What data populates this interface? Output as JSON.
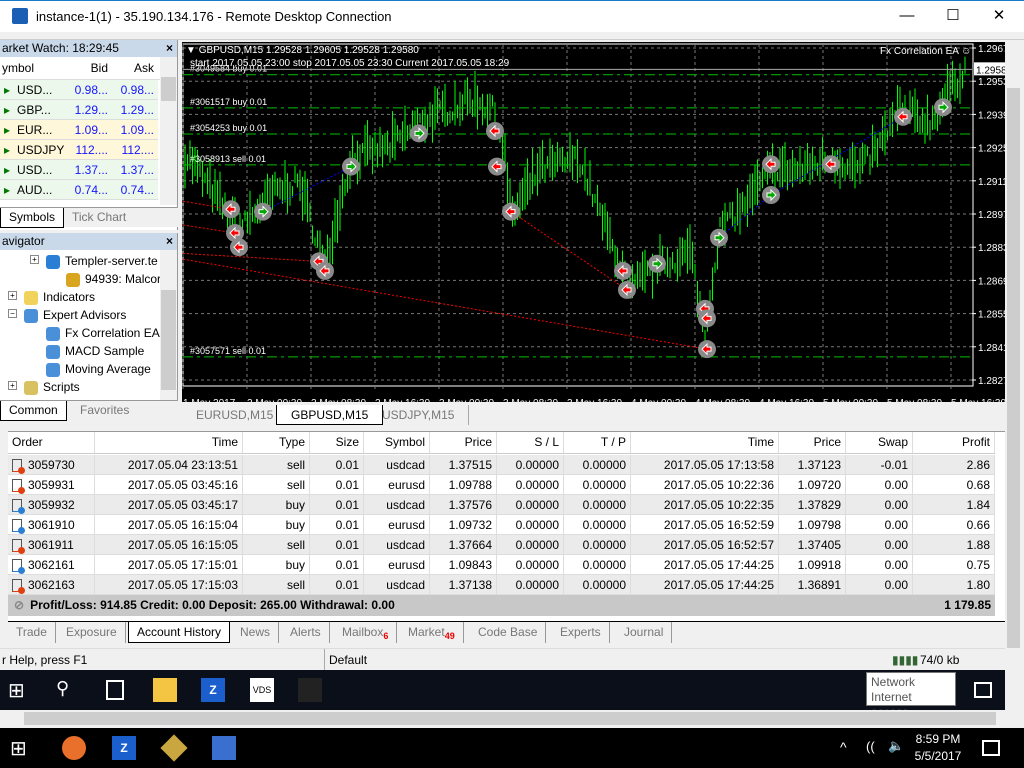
{
  "window": {
    "title": "instance-1(1) - 35.190.134.176 - Remote Desktop Connection",
    "minimize": "—",
    "maximize": "☐",
    "close": "✕"
  },
  "market_watch": {
    "title": "arket Watch: 18:29:45",
    "columns": [
      "ymbol",
      "Bid",
      "Ask"
    ],
    "rows": [
      {
        "symbol": "USD...",
        "bid": "0.98...",
        "ask": "0.98..."
      },
      {
        "symbol": "GBP...",
        "bid": "1.29...",
        "ask": "1.29..."
      },
      {
        "symbol": "EUR...",
        "bid": "1.09...",
        "ask": "1.09..."
      },
      {
        "symbol": "USDJPY",
        "bid": "112....",
        "ask": "112...."
      },
      {
        "symbol": "USD...",
        "bid": "1.37...",
        "ask": "1.37..."
      },
      {
        "symbol": "AUD...",
        "bid": "0.74...",
        "ask": "0.74..."
      }
    ],
    "tabs": [
      "Symbols",
      "Tick Chart"
    ]
  },
  "navigator": {
    "title": "avigator",
    "items": [
      {
        "label": "Templer-server.te",
        "icon": "server-icon"
      },
      {
        "label": "94939: Malcor",
        "icon": "account-icon"
      },
      {
        "label": "Indicators",
        "icon": "indicator-icon"
      },
      {
        "label": "Expert Advisors",
        "icon": "expert-icon"
      },
      {
        "label": "Fx Correlation EA",
        "icon": "expert-icon"
      },
      {
        "label": "MACD Sample",
        "icon": "expert-icon"
      },
      {
        "label": "Moving Average",
        "icon": "expert-icon"
      },
      {
        "label": "Scripts",
        "icon": "script-icon"
      }
    ],
    "tabs": [
      "Common",
      "Favorites"
    ]
  },
  "chart": {
    "header": "GBPUSD,M15  1.29528 1.29605 1.29528 1.29580",
    "info": "start 2017.05.05 23:00 stop 2017.05.05 23:30 Current 2017.05.05 18:29",
    "ea_label": "Fx Correlation EA",
    "current_price": "1.2958",
    "price_ticks": [
      "1.2967",
      "1.2953",
      "1.2939",
      "1.2925",
      "1.2911",
      "1.2897",
      "1.2883",
      "1.2869",
      "1.2855",
      "1.2841",
      "1.2827"
    ],
    "time_ticks": [
      "1 May 2017",
      "2 May 00:30",
      "2 May 08:30",
      "2 May 16:30",
      "3 May 00:30",
      "3 May 08:30",
      "3 May 16:30",
      "4 May 00:30",
      "4 May 08:30",
      "4 May 16:30",
      "5 May 00:30",
      "5 May 08:30",
      "5 May 16:30"
    ],
    "price_path": [
      [
        "05.01 17:15",
        1.292
      ],
      [
        "05.01 23:30",
        1.289
      ],
      [
        "05.02 03:30",
        1.2905
      ],
      [
        "05.02 07:00",
        1.291
      ],
      [
        "05.02 10:15",
        1.2875
      ],
      [
        "05.02 13:30",
        1.292
      ],
      [
        "05.02 18:30",
        1.2925
      ],
      [
        "05.02 22:00",
        1.2935
      ],
      [
        "05.03 04:30",
        1.2945
      ],
      [
        "05.03 07:30",
        1.294
      ],
      [
        "05.03 08:45",
        1.292
      ],
      [
        "05.03 09:30",
        1.2895
      ],
      [
        "05.03 13:00",
        1.2915
      ],
      [
        "05.03 18:00",
        1.292
      ],
      [
        "05.03 22:30",
        1.288
      ],
      [
        "05.04 00:30",
        1.2865
      ],
      [
        "05.04 04:00",
        1.2875
      ],
      [
        "05.04 08:00",
        1.288
      ],
      [
        "05.04 09:45",
        1.2845
      ],
      [
        "05.04 11:30",
        1.289
      ],
      [
        "05.04 14:45",
        1.29
      ],
      [
        "05.04 18:00",
        1.2915
      ],
      [
        "05.04 21:30",
        1.2915
      ],
      [
        "05.05 01:30",
        1.292
      ],
      [
        "05.05 05:00",
        1.2915
      ],
      [
        "05.05 07:30",
        1.2925
      ],
      [
        "05.05 10:00",
        1.294
      ],
      [
        "05.05 14:00",
        1.2935
      ],
      [
        "05.05 15:45",
        1.2945
      ],
      [
        "05.05 18:15",
        1.2958
      ]
    ],
    "order_lines": [
      {
        "label": "#3049584 buy 0.01",
        "price": 1.2957
      },
      {
        "label": "#3061517 buy 0.01",
        "price": 1.2943
      },
      {
        "label": "#3054253 buy 0.01",
        "price": 1.2932
      },
      {
        "label": "#3058913 sell 0.01",
        "price": 1.2919
      },
      {
        "label": "#3057571 sell 0.01",
        "price": 1.2838
      }
    ],
    "trades": [
      {
        "t": "05.01 22:30",
        "p": 1.2899,
        "type": "sell"
      },
      {
        "t": "05.01 23:00",
        "p": 1.2889,
        "type": "sell"
      },
      {
        "t": "05.01 23:30",
        "p": 1.2883,
        "type": "sell"
      },
      {
        "t": "05.02 02:30",
        "p": 1.2898,
        "type": "buy"
      },
      {
        "t": "05.02 09:30",
        "p": 1.2877,
        "type": "sell"
      },
      {
        "t": "05.02 10:15",
        "p": 1.2873,
        "type": "sell"
      },
      {
        "t": "05.02 13:30",
        "p": 1.2917,
        "type": "buy"
      },
      {
        "t": "05.02 22:00",
        "p": 1.2931,
        "type": "buy"
      },
      {
        "t": "05.03 07:30",
        "p": 1.2932,
        "type": "sell"
      },
      {
        "t": "05.03 07:45",
        "p": 1.2917,
        "type": "sell"
      },
      {
        "t": "05.03 09:30",
        "p": 1.2898,
        "type": "sell"
      },
      {
        "t": "05.03 23:30",
        "p": 1.2873,
        "type": "sell"
      },
      {
        "t": "05.04 00:00",
        "p": 1.2865,
        "type": "sell"
      },
      {
        "t": "05.04 03:45",
        "p": 1.2876,
        "type": "buy"
      },
      {
        "t": "05.04 09:45",
        "p": 1.2857,
        "type": "sell"
      },
      {
        "t": "05.04 10:00",
        "p": 1.2853,
        "type": "sell"
      },
      {
        "t": "05.04 10:00",
        "p": 1.284,
        "type": "sell"
      },
      {
        "t": "05.04 11:30",
        "p": 1.2887,
        "type": "buy"
      },
      {
        "t": "05.04 18:00",
        "p": 1.2918,
        "type": "sell"
      },
      {
        "t": "05.04 18:00",
        "p": 1.2905,
        "type": "buy"
      },
      {
        "t": "05.05 01:30",
        "p": 1.2918,
        "type": "sell"
      },
      {
        "t": "05.05 10:30",
        "p": 1.2938,
        "type": "sell"
      },
      {
        "t": "05.05 15:30",
        "p": 1.2942,
        "type": "buy"
      }
    ],
    "colors": {
      "bars": "#00ff00",
      "order_line": "#00c000",
      "grid": "#777777",
      "sell_link": "#ff0000",
      "buy_link": "#0000ff"
    }
  },
  "chart_tabs": [
    "EURUSD,M15",
    "GBPUSD,M15",
    "USDJPY,M15"
  ],
  "terminal": {
    "columns": [
      "Order",
      "Time",
      "Type",
      "Size",
      "Symbol",
      "Price",
      "S / L",
      "T / P",
      "Time",
      "Price",
      "Swap",
      "Profit"
    ],
    "rows": [
      [
        "3059730",
        "2017.05.04 23:13:51",
        "sell",
        "0.01",
        "usdcad",
        "1.37515",
        "0.00000",
        "0.00000",
        "2017.05.05 17:13:58",
        "1.37123",
        "-0.01",
        "2.86"
      ],
      [
        "3059931",
        "2017.05.05 03:45:16",
        "sell",
        "0.01",
        "eurusd",
        "1.09788",
        "0.00000",
        "0.00000",
        "2017.05.05 10:22:36",
        "1.09720",
        "0.00",
        "0.68"
      ],
      [
        "3059932",
        "2017.05.05 03:45:17",
        "buy",
        "0.01",
        "usdcad",
        "1.37576",
        "0.00000",
        "0.00000",
        "2017.05.05 10:22:35",
        "1.37829",
        "0.00",
        "1.84"
      ],
      [
        "3061910",
        "2017.05.05 16:15:04",
        "buy",
        "0.01",
        "eurusd",
        "1.09732",
        "0.00000",
        "0.00000",
        "2017.05.05 16:52:59",
        "1.09798",
        "0.00",
        "0.66"
      ],
      [
        "3061911",
        "2017.05.05 16:15:05",
        "sell",
        "0.01",
        "usdcad",
        "1.37664",
        "0.00000",
        "0.00000",
        "2017.05.05 16:52:57",
        "1.37405",
        "0.00",
        "1.88"
      ],
      [
        "3062161",
        "2017.05.05 17:15:01",
        "buy",
        "0.01",
        "eurusd",
        "1.09843",
        "0.00000",
        "0.00000",
        "2017.05.05 17:44:25",
        "1.09918",
        "0.00",
        "0.75"
      ],
      [
        "3062163",
        "2017.05.05 17:15:03",
        "sell",
        "0.01",
        "usdcad",
        "1.37138",
        "0.00000",
        "0.00000",
        "2017.05.05 17:44:25",
        "1.36891",
        "0.00",
        "1.80"
      ]
    ],
    "summary": "Profit/Loss: 914.85  Credit: 0.00  Deposit: 265.00  Withdrawal: 0.00",
    "total": "1 179.85",
    "tabs": [
      {
        "label": "Trade"
      },
      {
        "label": "Exposure"
      },
      {
        "label": "Account History",
        "active": true
      },
      {
        "label": "News"
      },
      {
        "label": "Alerts"
      },
      {
        "label": "Mailbox",
        "badge": "6"
      },
      {
        "label": "Market",
        "badge": "49"
      },
      {
        "label": "Code Base"
      },
      {
        "label": "Experts"
      },
      {
        "label": "Journal"
      }
    ]
  },
  "status_bar": {
    "help": "r Help, press F1",
    "profile": "Default",
    "traffic": "74/0 kb"
  },
  "tooltip": {
    "line1": "Network",
    "line2": "Internet access"
  },
  "clock": {
    "time": "8:59 PM",
    "date": "5/5/2017"
  }
}
